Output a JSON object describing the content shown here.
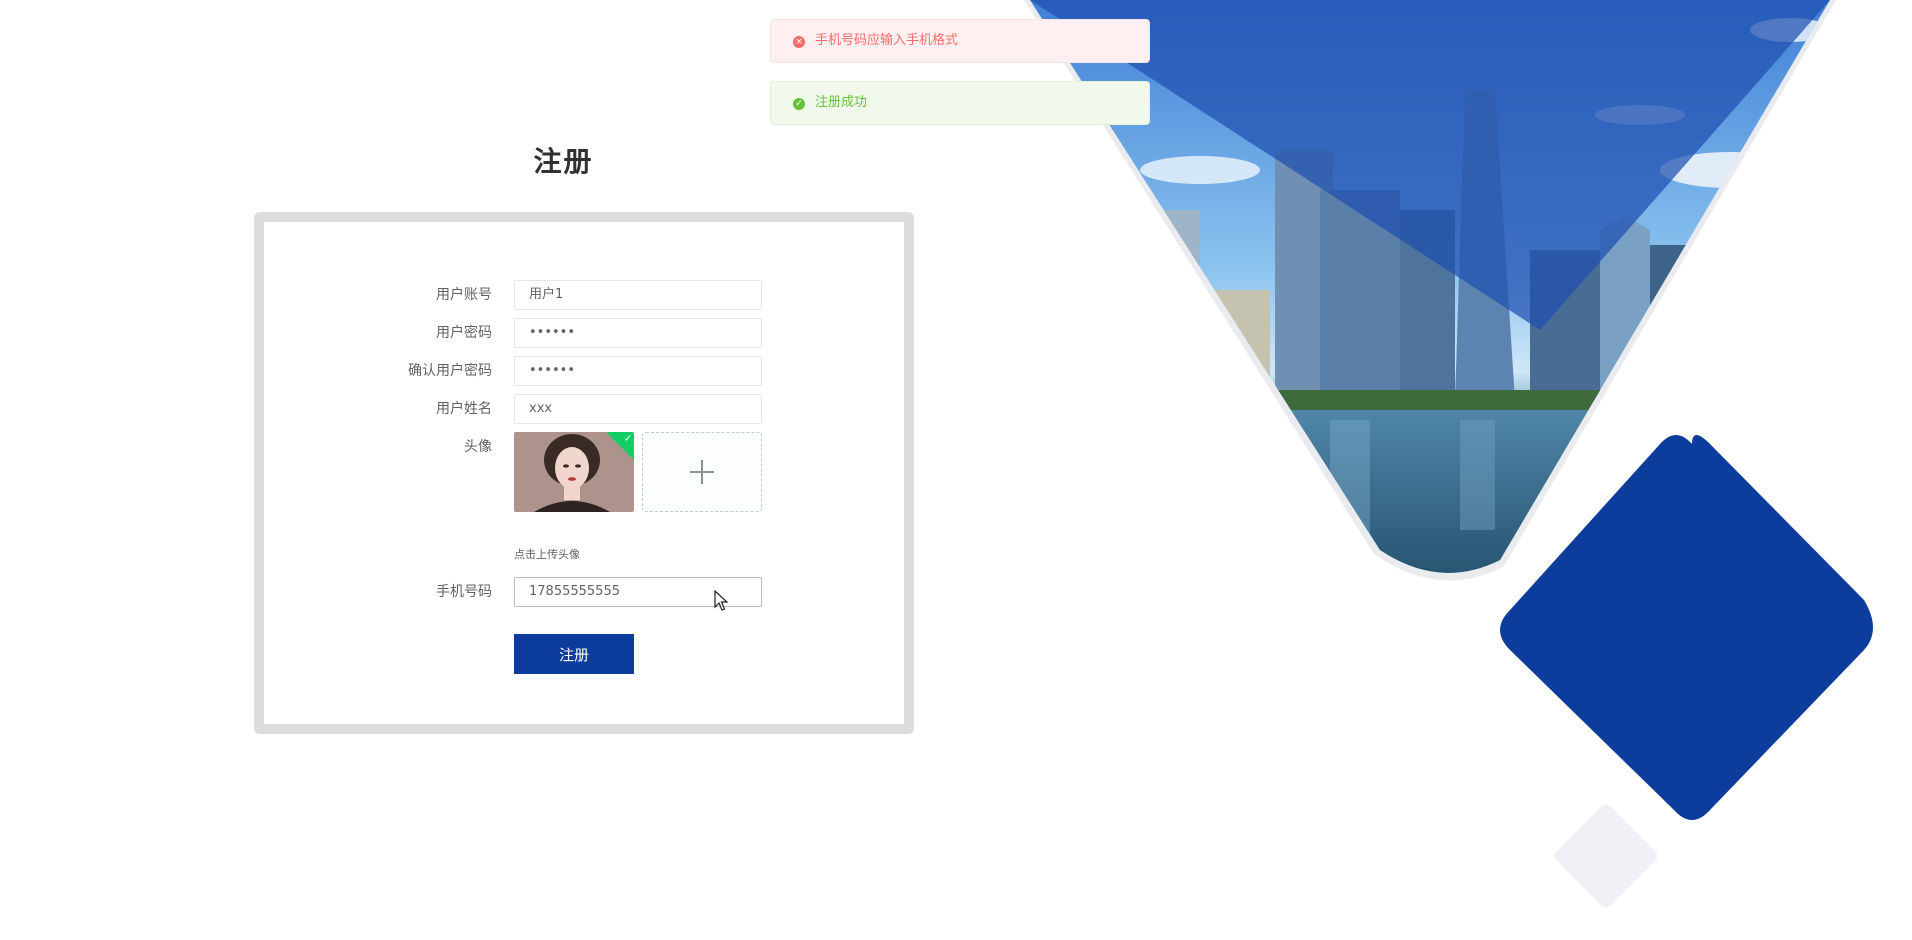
{
  "page": {
    "title": "注册"
  },
  "form": {
    "account": {
      "label": "用户账号",
      "value": "用户1"
    },
    "password": {
      "label": "用户密码",
      "value": "••••••"
    },
    "confirm_password": {
      "label": "确认用户密码",
      "value": "••••••"
    },
    "name": {
      "label": "用户姓名",
      "value": "xxx"
    },
    "avatar": {
      "label": "头像",
      "upload_tip": "点击上传头像"
    },
    "phone": {
      "label": "手机号码",
      "value": "17855555555"
    },
    "submit_label": "注册"
  },
  "messages": {
    "error": {
      "text": "手机号码应输入手机格式",
      "icon": "error-circle-icon"
    },
    "success": {
      "text": "注册成功",
      "icon": "success-circle-icon"
    }
  },
  "colors": {
    "accent": "#0c3d9c",
    "error": "#f56c6c",
    "success": "#67c23a"
  }
}
